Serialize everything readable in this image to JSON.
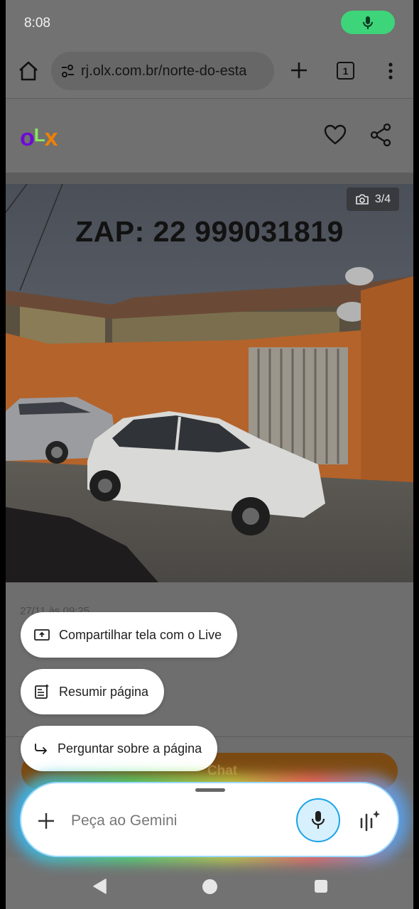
{
  "status_bar": {
    "time": "8:08",
    "mic_icon": "mic-icon",
    "mic_pill_color": "#3ed47a"
  },
  "browser": {
    "url": "rj.olx.com.br/norte-do-esta",
    "tab_count": "1",
    "icons": [
      "home-icon",
      "tune-icon",
      "plus-icon",
      "tabs-icon",
      "more-vert-icon"
    ]
  },
  "site": {
    "logo": {
      "letters": [
        "o",
        "L",
        "x"
      ],
      "colors": [
        "#6e0ad6",
        "#8ce563",
        "#f28000"
      ]
    },
    "actions": [
      "heart-icon",
      "share-icon"
    ]
  },
  "photo": {
    "counter": "3/4",
    "caption": "ZAP: 22 999031819"
  },
  "listing": {
    "date_partial": "27/11 às 09:25",
    "chat_label": "Chat",
    "chat_color": "#f28000"
  },
  "suggestions": [
    {
      "label": "Compartilhar tela com o Live",
      "icon": "screen-share-icon"
    },
    {
      "label": "Resumir página",
      "icon": "summarize-icon"
    },
    {
      "label": "Perguntar sobre a página",
      "icon": "ask-arrow-icon"
    }
  ],
  "gemini": {
    "placeholder": "Peça ao Gemini",
    "accent": "#1ba3e8",
    "icons": [
      "plus-icon",
      "mic-icon",
      "live-icon"
    ]
  },
  "nav": {
    "icons": [
      "back-icon",
      "home-icon",
      "recents-icon"
    ]
  }
}
